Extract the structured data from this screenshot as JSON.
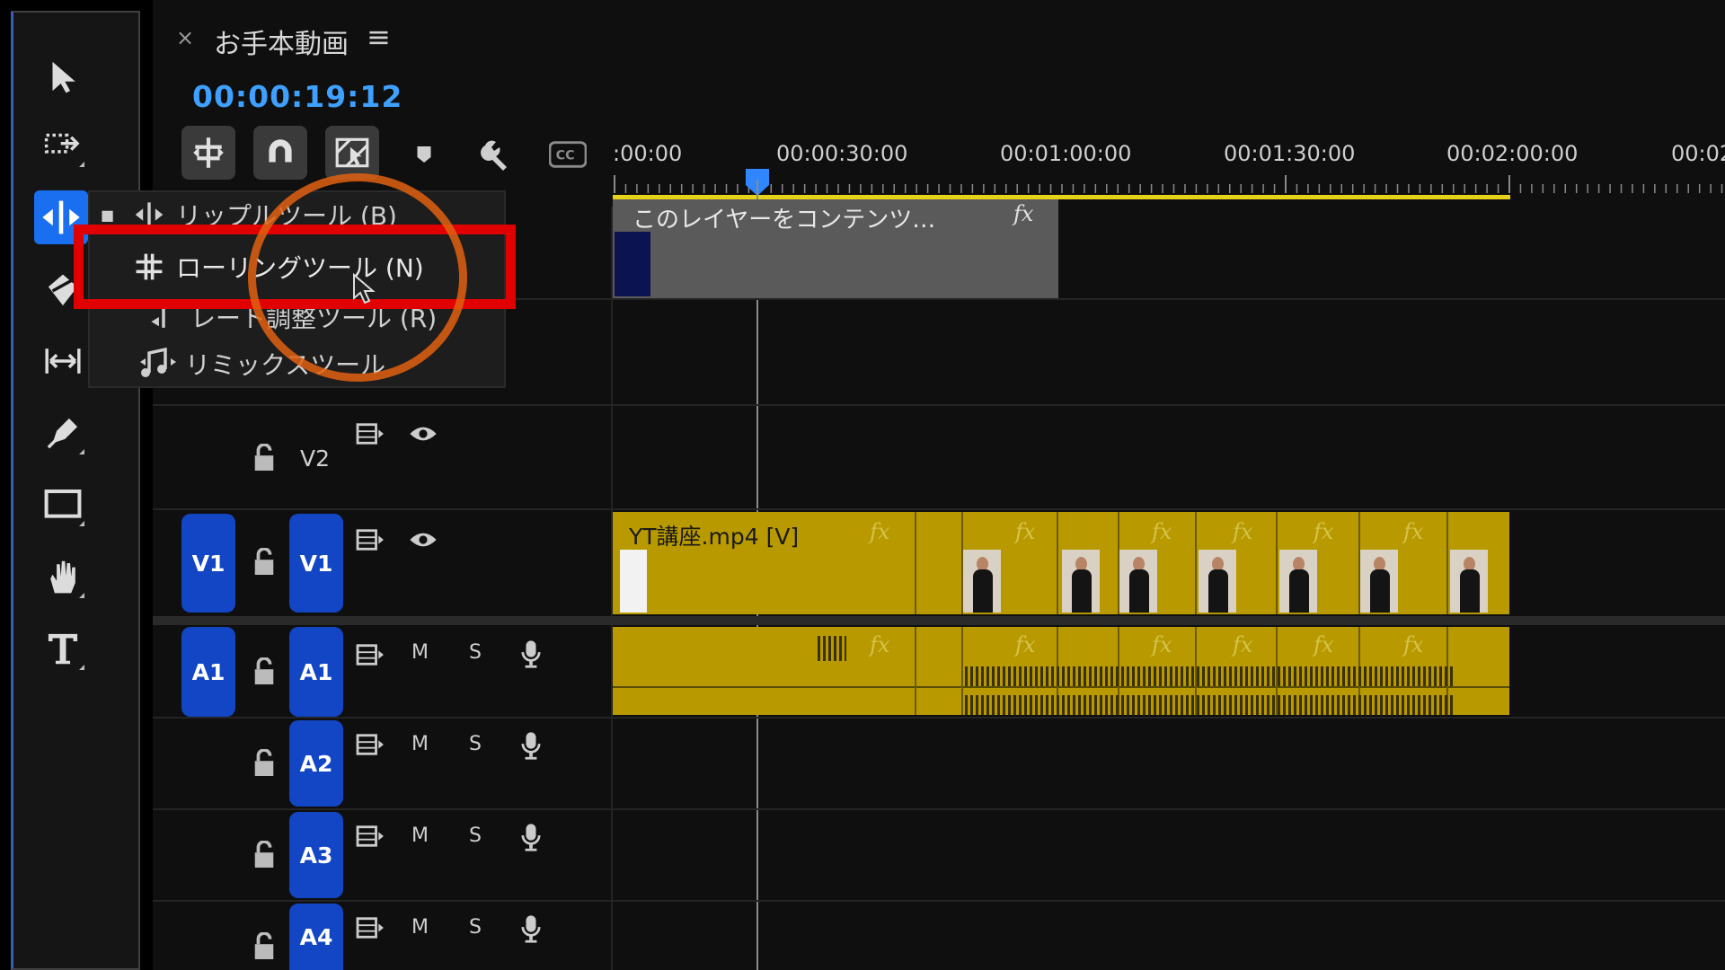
{
  "tools": [
    {
      "name": "selection-tool",
      "icon": "arrow-icon"
    },
    {
      "name": "track-select-tool",
      "icon": "track-select-icon"
    },
    {
      "name": "ripple-edit-tool",
      "icon": "ripple-edit-icon",
      "active": true
    },
    {
      "name": "razor-tool",
      "icon": "razor-icon"
    },
    {
      "name": "slip-tool",
      "icon": "slip-icon"
    },
    {
      "name": "pen-tool",
      "icon": "pen-icon"
    },
    {
      "name": "rectangle-tool",
      "icon": "rectangle-icon"
    },
    {
      "name": "hand-tool",
      "icon": "hand-icon"
    },
    {
      "name": "type-tool",
      "icon": "type-icon"
    }
  ],
  "sequence": {
    "close_glyph": "×",
    "title": "お手本動画",
    "menu_glyph": "≡",
    "timecode": "00:00:19:12"
  },
  "ruler": {
    "labels": [
      ":00:00",
      "00:00:30:00",
      "00:01:00:00",
      "00:01:30:00",
      "00:02:00:00",
      "00:02"
    ]
  },
  "menu": {
    "items": [
      {
        "label": "リップルツール (B)",
        "icon": "ripple-edit-icon",
        "checked": true
      },
      {
        "label": "ローリングツール (N)",
        "icon": "rolling-edit-icon",
        "highlighted": true
      },
      {
        "label": "レート調整ツール (R)",
        "icon": "rate-stretch-icon"
      },
      {
        "label": "リミックスツール",
        "icon": "remix-icon"
      }
    ]
  },
  "clips": {
    "adjustment_layer": "このレイヤーをコンテンツ…",
    "video_clip": "YT講座.mp4 [V]",
    "fx": "fx"
  },
  "tracks": {
    "video": [
      {
        "id": "V2",
        "source": ""
      },
      {
        "id": "V1",
        "source": "V1"
      }
    ],
    "audio": [
      {
        "id": "A1",
        "source": "A1"
      },
      {
        "id": "A2",
        "source": ""
      },
      {
        "id": "A3",
        "source": ""
      },
      {
        "id": "A4",
        "source": ""
      }
    ],
    "mute": "M",
    "solo": "S"
  },
  "colors": {
    "accent": "#1a6ff0",
    "timecode": "#3ea0ff",
    "clip": "#b89a00",
    "highlight_box": "#e00000",
    "circle": "#e06010"
  }
}
